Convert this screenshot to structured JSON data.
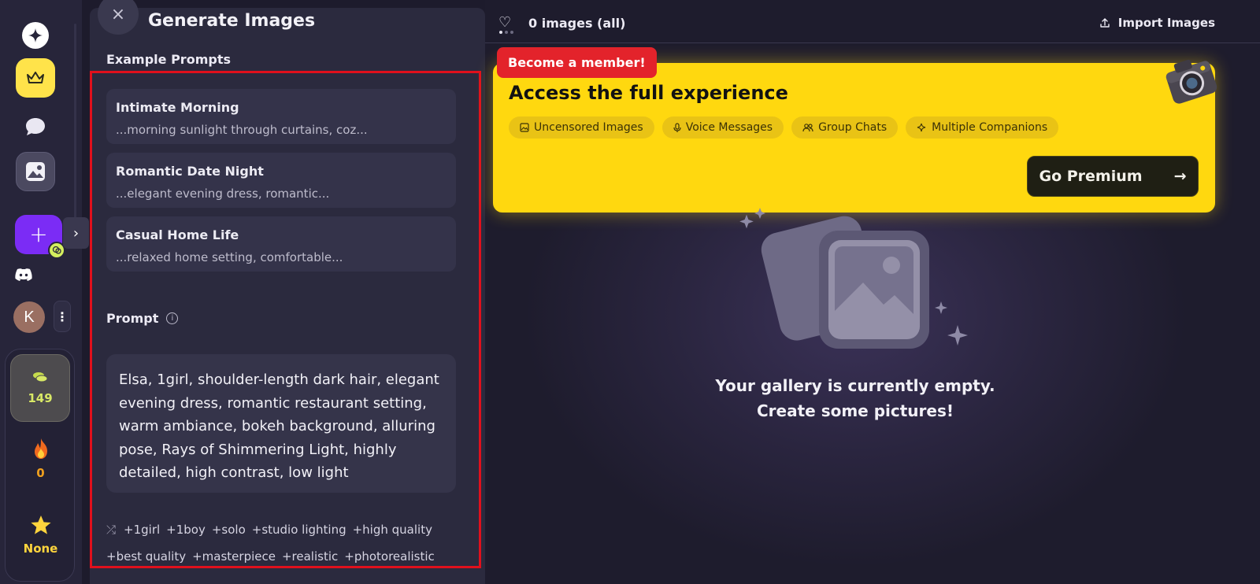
{
  "colors": {
    "accent_yellow": "#ffd80f",
    "create_purple": "#7b2cf5",
    "badge_red": "#e3232b",
    "highlight_red": "#e0101c",
    "panel_bg": "#2b2a3e"
  },
  "rail": {
    "logo_icon": "sparkle-icon",
    "premium_icon": "crown-icon",
    "chat_icon": "chat-bubble-icon",
    "gallery_icon": "image-icon",
    "create_icon": "plus-icon",
    "expand_icon": "chevron-right-icon",
    "discord_icon": "discord-icon",
    "avatar_initial": "K",
    "more_icon": "vertical-dots-icon",
    "coins": "149",
    "streak": "0",
    "level": "None"
  },
  "panel": {
    "close_icon": "close-icon",
    "title": "Generate Images",
    "examples_label": "Example Prompts",
    "examples": [
      {
        "title": "Intimate Morning",
        "desc": "...morning sunlight through curtains, coz..."
      },
      {
        "title": "Romantic Date Night",
        "desc": "...elegant evening dress, romantic..."
      },
      {
        "title": "Casual Home Life",
        "desc": "...relaxed home setting, comfortable..."
      }
    ],
    "prompt_label": "Prompt",
    "prompt_text": "Elsa, 1girl, shoulder-length dark hair, elegant evening dress, romantic restaurant setting, warm ambiance, bokeh background, alluring pose, Rays of Shimmering Light, highly detailed, high contrast, low light",
    "tags": [
      "+1girl",
      "+1boy",
      "+solo",
      "+studio lighting",
      "+high quality",
      "+best quality",
      "+masterpiece",
      "+realistic",
      "+photorealistic"
    ]
  },
  "main": {
    "count_label": "0 images (all)",
    "import_label": "Import Images",
    "member_badge": "Become a member!",
    "promo_title": "Access the full experience",
    "features": [
      "Uncensored Images",
      "Voice Messages",
      "Group Chats",
      "Multiple Companions"
    ],
    "cta_label": "Go Premium",
    "empty_line1": "Your gallery is currently empty.",
    "empty_line2": "Create some pictures!"
  }
}
